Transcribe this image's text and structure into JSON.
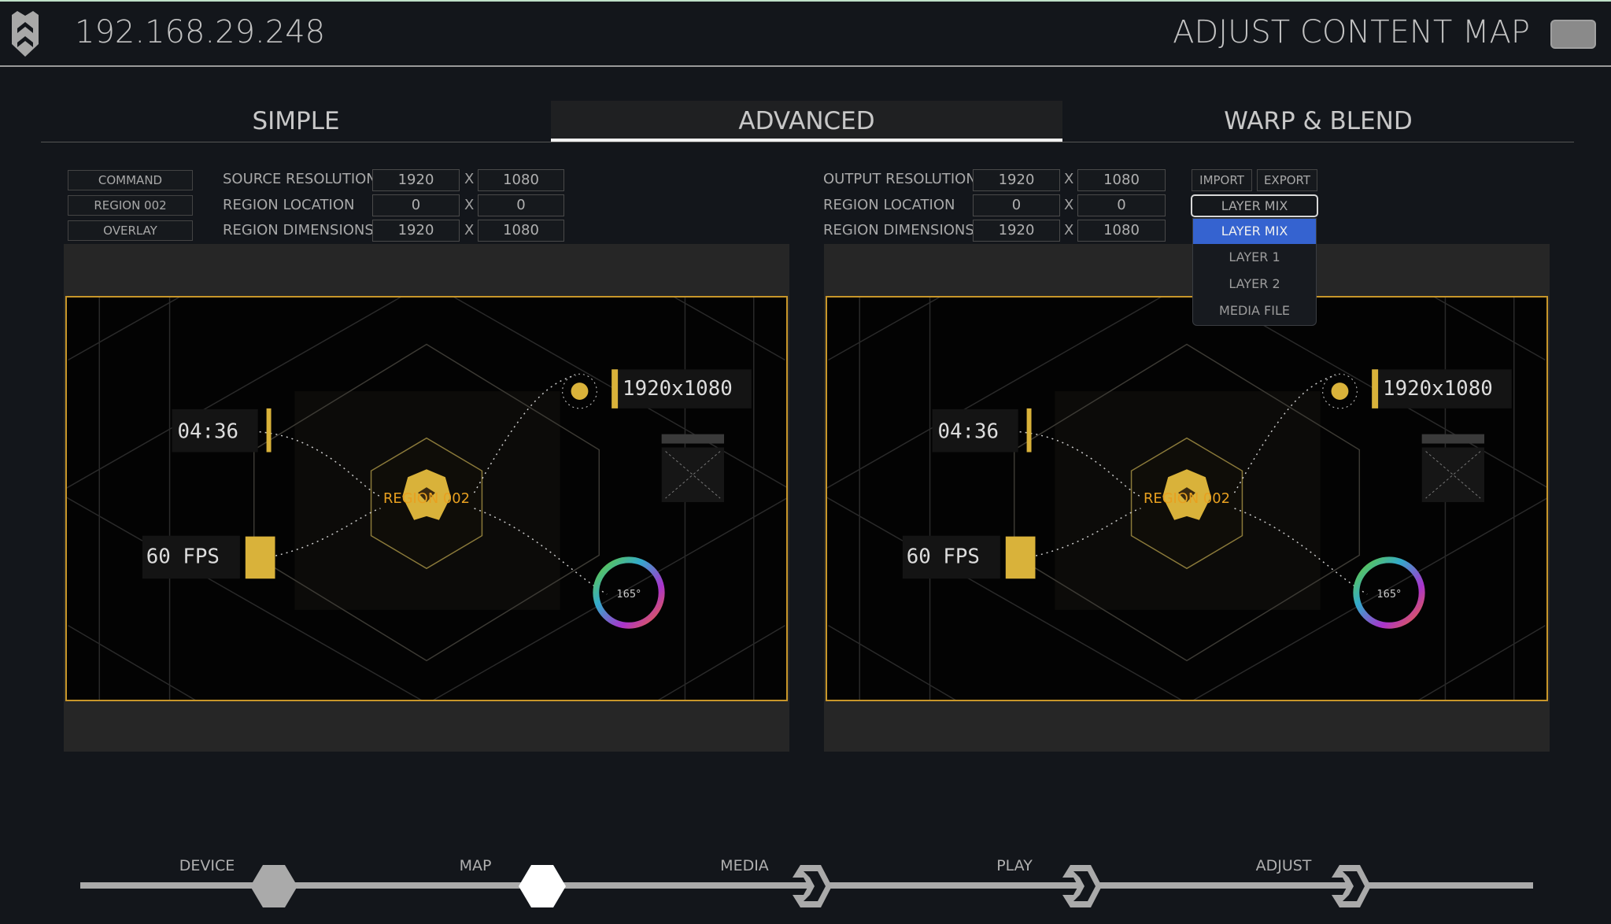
{
  "header": {
    "ip": "192.168.29.248",
    "title": "ADJUST CONTENT MAP",
    "logo": "shield-logo-icon"
  },
  "tabs": [
    {
      "label": "SIMPLE"
    },
    {
      "label": "ADVANCED",
      "active": true
    },
    {
      "label": "WARP & BLEND"
    }
  ],
  "left": {
    "buttons": [
      "COMMAND",
      "REGION 002",
      "OVERLAY"
    ],
    "rows": [
      {
        "label": "SOURCE RESOLUTION",
        "a": "1920",
        "b": "1080"
      },
      {
        "label": "REGION LOCATION",
        "a": "0",
        "b": "0"
      },
      {
        "label": "REGION DIMENSIONS",
        "a": "1920",
        "b": "1080"
      }
    ],
    "separator": "X"
  },
  "right": {
    "rows": [
      {
        "label": "OUTPUT RESOLUTION",
        "a": "1920",
        "b": "1080"
      },
      {
        "label": "REGION LOCATION",
        "a": "0",
        "b": "0"
      },
      {
        "label": "REGION DIMENSIONS",
        "a": "1920",
        "b": "1080"
      }
    ],
    "import": "IMPORT",
    "export": "EXPORT",
    "layer_select": {
      "value": "LAYER MIX",
      "options": [
        "LAYER MIX",
        "LAYER 1",
        "LAYER 2",
        "MEDIA FILE"
      ],
      "selected_index": 0
    }
  },
  "preview": {
    "region_label": "REGION 002",
    "time": "04:36",
    "resolution": "1920x1080",
    "fps": "60 FPS",
    "angle": "165°",
    "border_color": "#c8962a",
    "accent": "#d9b23a"
  },
  "steps": [
    {
      "label": "DEVICE",
      "state": "done"
    },
    {
      "label": "MAP",
      "state": "current"
    },
    {
      "label": "MEDIA",
      "state": "todo"
    },
    {
      "label": "PLAY",
      "state": "todo"
    },
    {
      "label": "ADJUST",
      "state": "todo"
    }
  ],
  "colors": {
    "bg": "#13161b",
    "select_highlight": "#3563d0"
  }
}
